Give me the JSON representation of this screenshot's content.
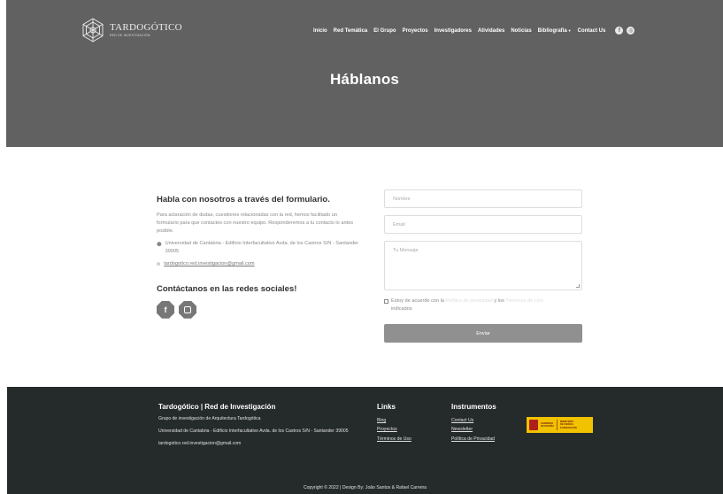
{
  "brand": {
    "name": "TARDOGÓTICO",
    "subtitle": "RED DE INVESTIGACIÓN"
  },
  "nav": {
    "items": [
      {
        "label": "Inicio",
        "key": "inicio"
      },
      {
        "label": "Red Temática",
        "key": "red-tematica"
      },
      {
        "label": "El Grupo",
        "key": "el-grupo"
      },
      {
        "label": "Proyectos",
        "key": "proyectos"
      },
      {
        "label": "Investigadores",
        "key": "investigadores"
      },
      {
        "label": "Atividades",
        "key": "atividades"
      },
      {
        "label": "Noticias",
        "key": "noticias"
      },
      {
        "label": "Bibliografia",
        "key": "bibliografia",
        "dropdown": true
      },
      {
        "label": "Contact Us",
        "key": "contact-us"
      }
    ],
    "social": [
      {
        "icon": "facebook-icon",
        "glyph": "f"
      },
      {
        "icon": "instagram-icon",
        "glyph": "◎"
      }
    ]
  },
  "hero": {
    "title": "Háblanos"
  },
  "contact": {
    "heading": "Habla con nosotros a través del formulario.",
    "description": "Para aclaración de dudas, cuestiones relacionadas con la red, hemos facilitado un formulario para que contactes con nuestro equipo. Responderemos a tu contacto lo antes posible.",
    "address": "Universidad de Cantabria - Edificio Interfacultativo Avda. de los Castros S/N - Santander 39005",
    "email": "tardogotico.red.investigacion@gmail.com",
    "social_heading": "Contáctanos en las redes sociales!"
  },
  "form": {
    "name_placeholder": "Nombre",
    "email_placeholder": "Email",
    "message_placeholder": "Tu Mensaje",
    "consent_prefix": "Estoy de acuerdo con la",
    "consent_privacy": "Política de privacidad",
    "consent_and": "y los",
    "consent_terms": "Términos de Uso",
    "consent_suffix": "indicados",
    "submit_label": "Enviar"
  },
  "footer": {
    "brand_title": "Tardogótico | Red de Investigación",
    "brand_desc": "Grupo de investigación de Arquitectura Tardogótica",
    "address": "Universidad de Cantabria - Edificio Interfacultativo Avda. de los Castros S/N - Santander 39005",
    "email": "tardogotico.red.investigacion@gmail.com",
    "links_heading": "Links",
    "links": [
      "Blog",
      "Proyectos",
      "Términos de Uso"
    ],
    "instr_heading": "Instrumentos",
    "instr": [
      "Contact Us",
      "Newsletter",
      "Política de Privacidad"
    ],
    "gov_text_1": "GOBIERNO\nDE ESPAÑA",
    "gov_text_2": "MINISTERIO\nDE CIENCIA\nE INNOVACIÓN",
    "copyright": "Copyright © 2022 | Design By: João Santos & Rafael Carreira"
  },
  "colors": {
    "hero_bg": "#616161",
    "footer_bg": "#252a2a",
    "button_bg": "#909090",
    "gov_yellow": "#f0c200"
  }
}
